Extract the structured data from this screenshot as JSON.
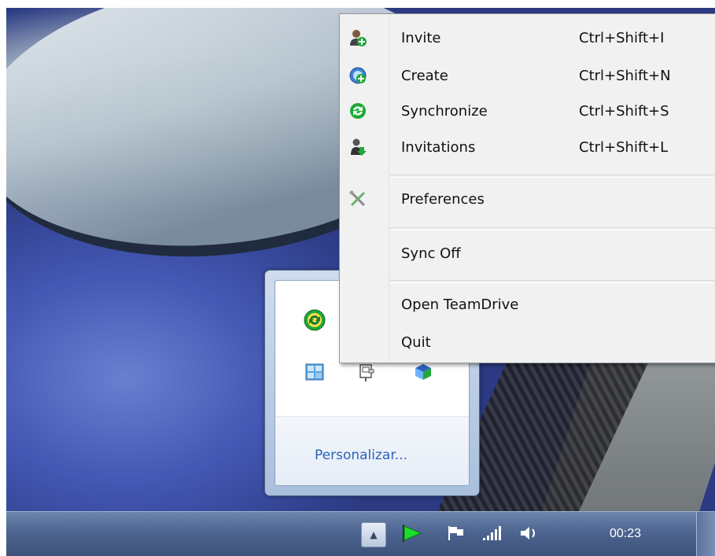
{
  "context_menu": {
    "items": [
      {
        "label": "Invite",
        "shortcut": "Ctrl+Shift+I",
        "icon": "invite-user-icon"
      },
      {
        "label": "Create",
        "shortcut": "Ctrl+Shift+N",
        "icon": "create-space-icon"
      },
      {
        "label": "Synchronize",
        "shortcut": "Ctrl+Shift+S",
        "icon": "sync-icon"
      },
      {
        "label": "Invitations",
        "shortcut": "Ctrl+Shift+L",
        "icon": "invitations-icon"
      },
      {
        "label": "Preferences",
        "shortcut": "",
        "icon": "preferences-tools-icon"
      },
      {
        "label": "Sync Off",
        "shortcut": "",
        "icon": ""
      },
      {
        "label": "Open TeamDrive",
        "shortcut": "",
        "icon": ""
      },
      {
        "label": "Quit",
        "shortcut": "",
        "icon": ""
      }
    ]
  },
  "tray_overflow": {
    "icons": [
      "teamdrive-sync-icon",
      "window-grid-icon",
      "network-plug-icon",
      "teamdrive-app-icon"
    ],
    "customize_label": "Personalizar..."
  },
  "taskbar": {
    "clock": "00:23",
    "tray_icons": [
      "show-hidden-icons-arrow",
      "teamdrive-flag-icon",
      "action-center-flag-icon",
      "signal-bars-icon",
      "volume-icon"
    ]
  },
  "colors": {
    "menu_bg": "#f1f1f1",
    "link_blue": "#2a63b8",
    "teamdrive_green": "#1fa83a",
    "taskbar_blue": "#4d6590"
  }
}
